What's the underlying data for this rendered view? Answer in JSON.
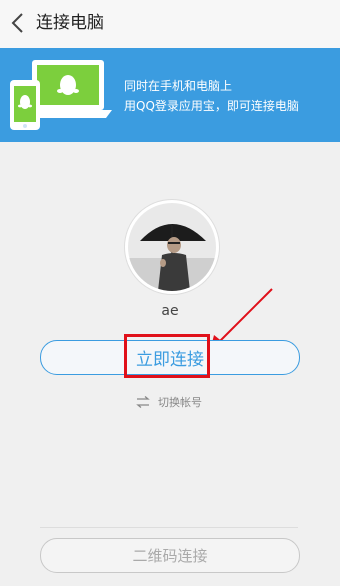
{
  "header": {
    "title": "连接电脑",
    "back_icon": "chevron-left-icon"
  },
  "banner": {
    "line1": "同时在手机和电脑上",
    "line2": "用QQ登录应用宝，即可连接电脑",
    "background": "#3b9ce0",
    "illustration": "qq-devices-illustration"
  },
  "account": {
    "username": "ae",
    "avatar": "user-avatar"
  },
  "actions": {
    "connect_label": "立即连接",
    "switch_account_label": "切换帐号",
    "switch_icon": "swap-icon",
    "qr_connect_label": "二维码连接"
  },
  "colors": {
    "accent": "#3b9ce0",
    "highlight": "#e0101a"
  }
}
